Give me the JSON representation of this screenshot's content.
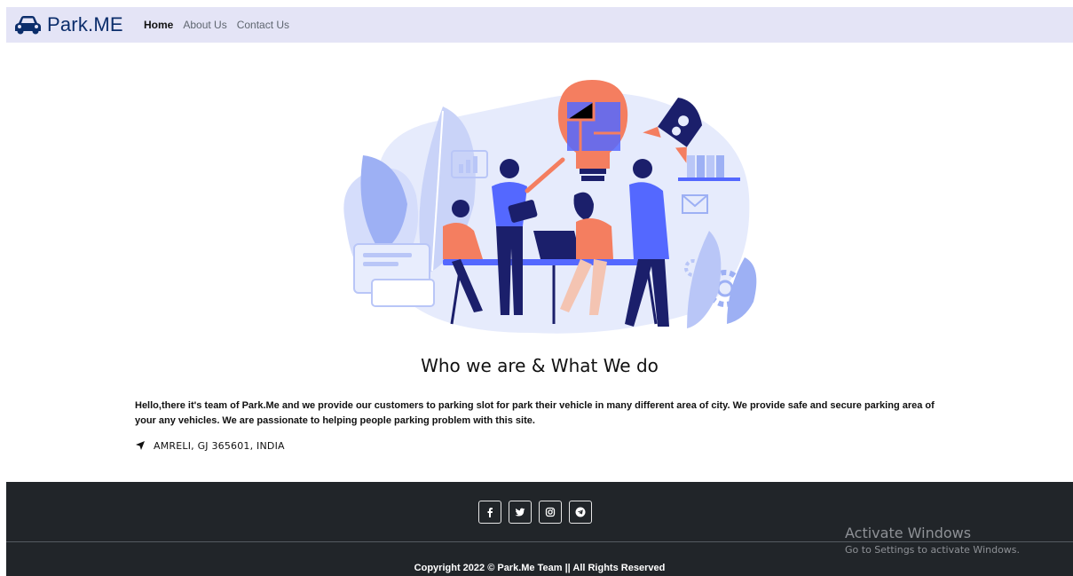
{
  "navbar": {
    "brand": "Park.ME",
    "brand_icon": "car-icon",
    "links": [
      {
        "label": "Home",
        "active": true
      },
      {
        "label": "About Us",
        "active": false
      },
      {
        "label": "Contact Us",
        "active": false
      }
    ]
  },
  "illustration": {
    "icon": "team-brainstorm-illustration"
  },
  "about": {
    "heading": "Who we are & What We do",
    "paragraph": "Hello,there it's team of Park.Me and we provide our customers to parking slot for park their vehicle in many different area of city. We provide safe and secure parking area of your any vehicles. We are passionate to helping people parking problem with this site.",
    "address_icon": "location-arrow-icon",
    "address": "AMRELI, GJ 365601, INDIA"
  },
  "footer": {
    "social": [
      {
        "name": "facebook",
        "icon": "facebook-icon"
      },
      {
        "name": "twitter",
        "icon": "twitter-icon"
      },
      {
        "name": "instagram",
        "icon": "instagram-icon"
      },
      {
        "name": "telegram",
        "icon": "telegram-icon"
      }
    ],
    "copyright": "Copyright 2022 © Park.Me Team || All Rights Reserved"
  },
  "watermark": {
    "title": "Activate Windows",
    "subtitle": "Go to Settings to activate Windows."
  },
  "colors": {
    "navbar_bg": "#e4e4f6",
    "brand": "#0b2d6b",
    "footer_bg": "#212529",
    "illustration_orange": "#f47e60",
    "illustration_navy": "#1b1f6b",
    "illustration_blue": "#5468ff"
  }
}
